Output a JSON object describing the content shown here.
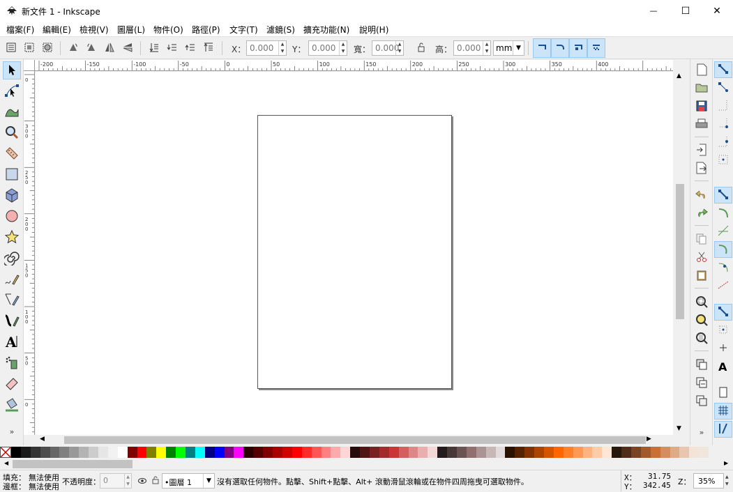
{
  "window": {
    "title": "新文件 1 - Inkscape",
    "minimize": "—",
    "maximize": "☐",
    "close": "✕"
  },
  "menu": [
    "檔案(F)",
    "編輯(E)",
    "檢視(V)",
    "圖層(L)",
    "物件(O)",
    "路徑(P)",
    "文字(T)",
    "濾鏡(S)",
    "擴充功能(N)",
    "說明(H)"
  ],
  "toolbar": {
    "x_label": "X：",
    "x_value": "0.000",
    "y_label": "Y：",
    "y_value": "0.000",
    "w_label": "寬：",
    "w_value": "0.000",
    "h_label": "高：",
    "h_value": "0.000",
    "unit": "mm"
  },
  "ruler": {
    "h_labels": [
      "-200",
      "-150",
      "-100",
      "-50",
      "0",
      "50",
      "100",
      "150",
      "200",
      "250",
      "300",
      "350",
      "400"
    ],
    "v_labels": [
      "0",
      "300",
      "250",
      "200",
      "150",
      "100",
      "50",
      "0"
    ]
  },
  "palette": {
    "colors": [
      "#000000",
      "#1a1a1a",
      "#333333",
      "#4d4d4d",
      "#666666",
      "#808080",
      "#999999",
      "#b3b3b3",
      "#cccccc",
      "#e6e6e6",
      "#f2f2f2",
      "#ffffff",
      "#800000",
      "#ff0000",
      "#808000",
      "#ffff00",
      "#008000",
      "#00ff00",
      "#008080",
      "#00ffff",
      "#000080",
      "#0000ff",
      "#800080",
      "#ff00ff",
      "#2b0000",
      "#550000",
      "#800000",
      "#aa0000",
      "#d40000",
      "#ff0000",
      "#ff2a2a",
      "#ff5555",
      "#ff8080",
      "#ffaaaa",
      "#ffd5d5",
      "#280b0b",
      "#501616",
      "#782121",
      "#a02c2c",
      "#c83737",
      "#d35f5f",
      "#de8787",
      "#e9afaf",
      "#f4d7d7",
      "#241c1c",
      "#483737",
      "#6c5353",
      "#916f6f",
      "#ac9393",
      "#c8b7b7",
      "#e3dbdb",
      "#2b1100",
      "#552200",
      "#803300",
      "#aa4400",
      "#d45500",
      "#ff6600",
      "#ff7f2a",
      "#ff9955",
      "#ffb380",
      "#ffccaa",
      "#ffe6d5",
      "#28170b",
      "#502d16",
      "#784421",
      "#a05a2c",
      "#c87137",
      "#d38d5f",
      "#deaa87",
      "#e9c6af",
      "#f4e3d7",
      "#f0e6dc"
    ]
  },
  "status": {
    "fill_label": "填充：",
    "fill_value": "無法使用",
    "stroke_label": "邊框：",
    "stroke_value": "無法使用",
    "opacity_label": "不透明度：",
    "opacity_value": "0",
    "layer": "•圖層 1",
    "message": "沒有選取任何物件。點擊、Shift+點擊、Alt+ 滾動滑鼠滾輪或在物件四周拖曳可選取物件。",
    "x_label": "X：",
    "x_value": "31.75",
    "y_label": "Y：",
    "y_value": "342.45",
    "zoom_label": "Z：",
    "zoom_value": "35%"
  }
}
